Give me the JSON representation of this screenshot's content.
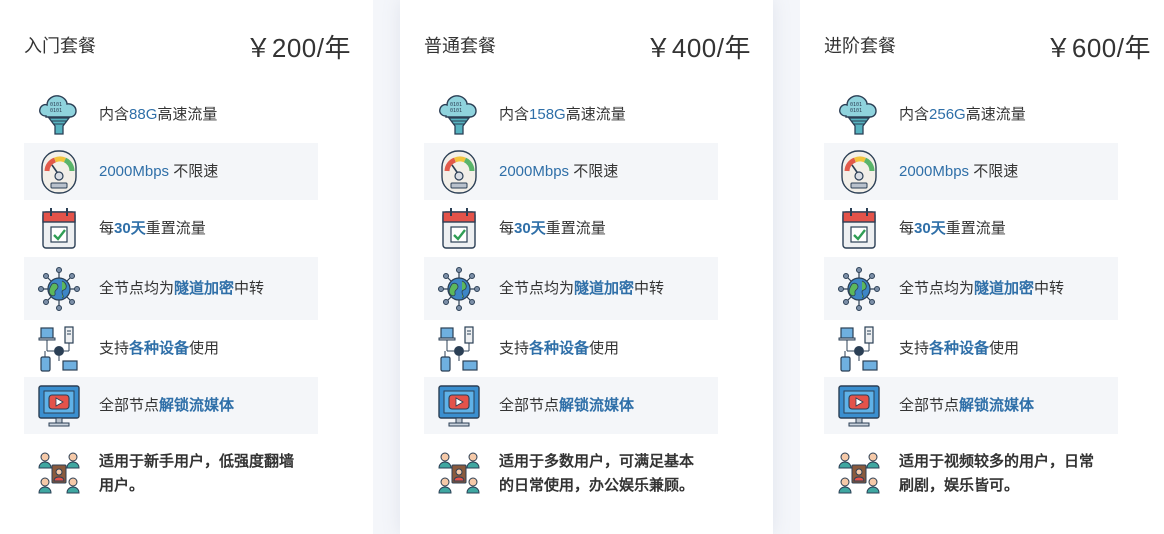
{
  "plans": [
    {
      "name": "入门套餐",
      "price": "￥200/年",
      "traffic": {
        "pre": "内含",
        "value": "88G",
        "post": "高速流量"
      },
      "speed": {
        "value": "2000Mbps",
        "post": " 不限速"
      },
      "reset": {
        "pre": "每",
        "value": "30天",
        "post": "重置流量"
      },
      "relay": {
        "pre": "全节点均为",
        "value": "隧道加密",
        "post": "中转"
      },
      "devices": {
        "pre": "支持",
        "value": "各种设备",
        "post": "使用"
      },
      "unlock": {
        "pre": "全部节点",
        "value": "解锁流媒体"
      },
      "audience": "适用于新手用户，低强度翻墙用户。"
    },
    {
      "name": "普通套餐",
      "price": "￥400/年",
      "traffic": {
        "pre": "内含",
        "value": "158G",
        "post": "高速流量"
      },
      "speed": {
        "value": "2000Mbps",
        "post": " 不限速"
      },
      "reset": {
        "pre": "每",
        "value": "30天",
        "post": "重置流量"
      },
      "relay": {
        "pre": "全节点均为",
        "value": "隧道加密",
        "post": "中转"
      },
      "devices": {
        "pre": "支持",
        "value": "各种设备",
        "post": "使用"
      },
      "unlock": {
        "pre": "全部节点",
        "value": "解锁流媒体"
      },
      "audience": "适用于多数用户，可满足基本的日常使用，办公娱乐兼顾。"
    },
    {
      "name": "进阶套餐",
      "price": "￥600/年",
      "traffic": {
        "pre": "内含",
        "value": "256G",
        "post": "高速流量"
      },
      "speed": {
        "value": "2000Mbps",
        "post": " 不限速"
      },
      "reset": {
        "pre": "每",
        "value": "30天",
        "post": "重置流量"
      },
      "relay": {
        "pre": "全节点均为",
        "value": "隧道加密",
        "post": "中转"
      },
      "devices": {
        "pre": "支持",
        "value": "各种设备",
        "post": "使用"
      },
      "unlock": {
        "pre": "全部节点",
        "value": "解锁流媒体"
      },
      "audience": "适用于视频较多的用户，日常刷剧，娱乐皆可。"
    }
  ],
  "icons": [
    "cloud-data-icon",
    "speedometer-icon",
    "calendar-check-icon",
    "globe-network-icon",
    "devices-icon",
    "video-monitor-icon",
    "users-icon"
  ],
  "colors": {
    "accent": "#2f6fa8",
    "text": "#333333",
    "row_shade": "#f4f6f9",
    "background": "#f4f6fa"
  }
}
